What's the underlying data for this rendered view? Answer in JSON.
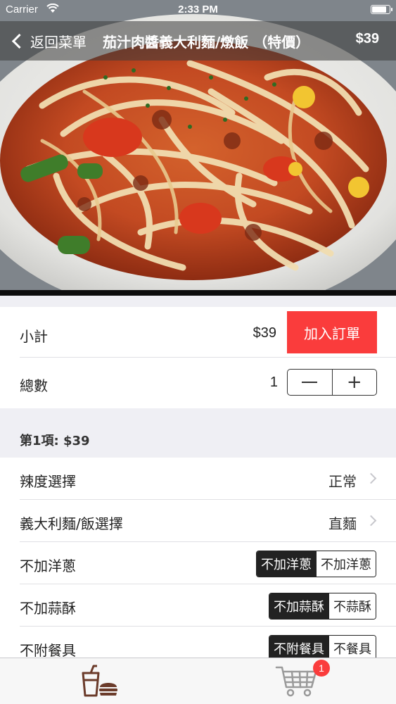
{
  "status_bar": {
    "carrier": "Carrier",
    "time": "2:33 PM",
    "battery_level": 0.9
  },
  "nav": {
    "back_label": "返回菜單",
    "title": "茄汁肉醬義大利麵/燉飯 （特價）",
    "price": "$39"
  },
  "hero": {
    "icon": "spaghetti-photo"
  },
  "summary": {
    "subtotal_label": "小計",
    "subtotal_value": "$39",
    "add_to_order_label": "加入訂單",
    "quantity_label": "總數",
    "quantity_value": "1",
    "minus_symbol": "—",
    "plus_symbol": "+"
  },
  "item_section": {
    "title": "第1項: $39"
  },
  "options": {
    "spice": {
      "label": "辣度選擇",
      "value": "正常"
    },
    "noodle_rice": {
      "label": "義大利麵/飯選擇",
      "value": "直麵"
    },
    "onion": {
      "label": "不加洋蔥",
      "options": [
        "不加洋蔥",
        "不加洋蔥"
      ],
      "selected_index": 0
    },
    "garlic": {
      "label": "不加蒜酥",
      "options": [
        "不加蒜酥",
        "不蒜酥"
      ],
      "selected_index": 0
    },
    "cutlery": {
      "label": "不附餐具",
      "options": [
        "不附餐具",
        "不餐具"
      ],
      "selected_index": 0
    }
  },
  "tab_bar": {
    "menu_icon": "drink-burger-icon",
    "cart_icon": "cart-icon",
    "cart_badge": "1"
  },
  "colors": {
    "accent_red": "#fa3c3c",
    "segment_dark": "#222222",
    "group_background": "#efeff4",
    "tab_icon_brown": "#6b3b2a"
  }
}
